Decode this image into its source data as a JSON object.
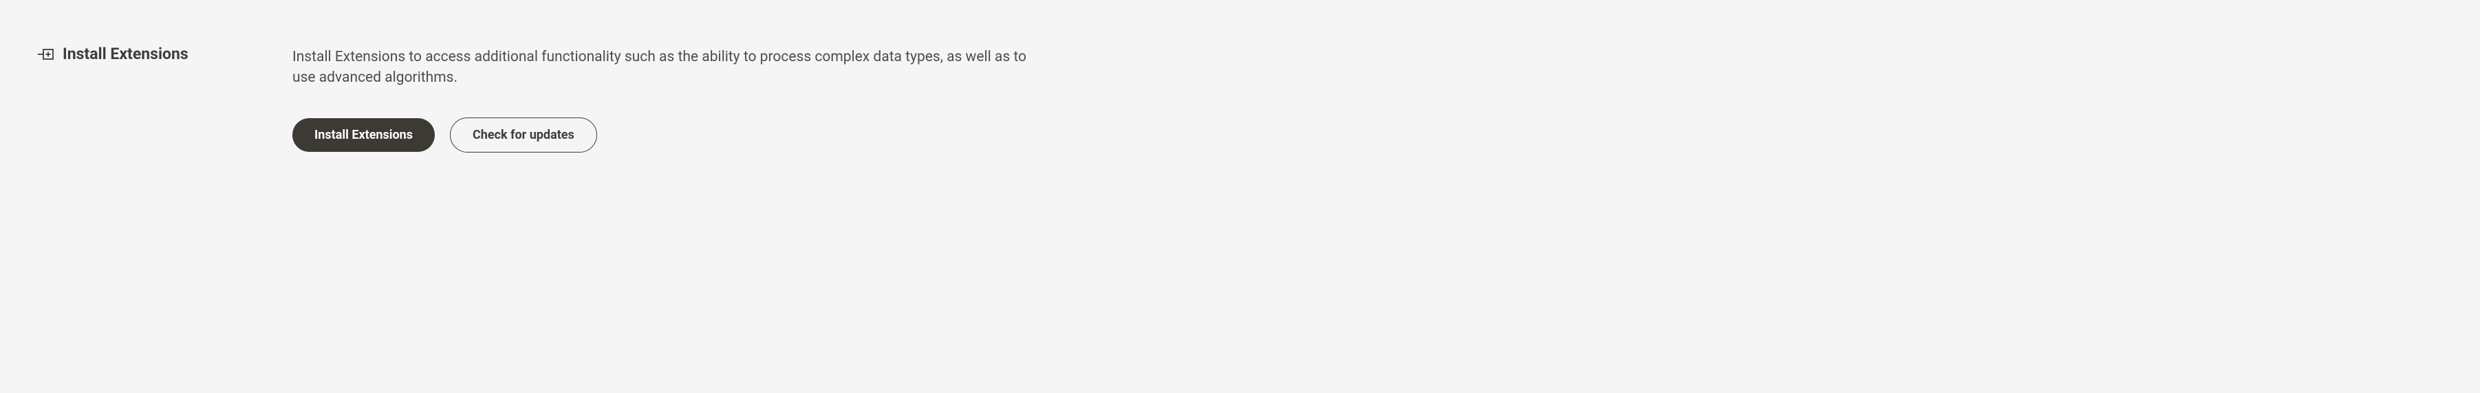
{
  "section": {
    "title": "Install Extensions",
    "description": "Install Extensions to access additional functionality such as the ability to process complex data types, as well as to use advanced algorithms.",
    "actions": {
      "primary_label": "Install Extensions",
      "secondary_label": "Check for updates"
    }
  }
}
